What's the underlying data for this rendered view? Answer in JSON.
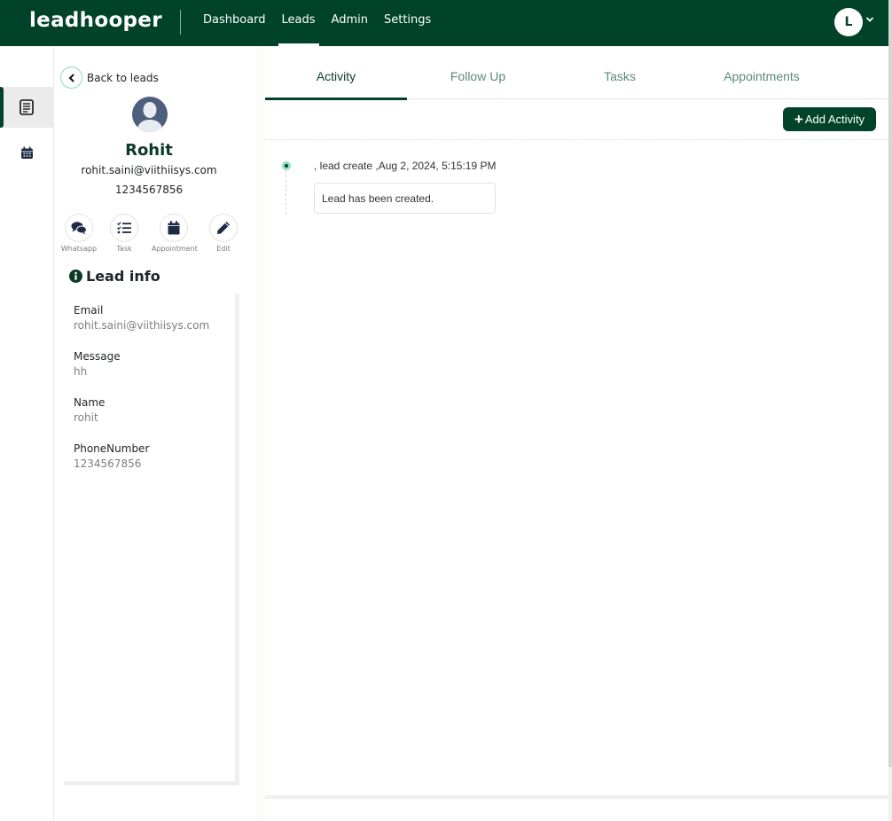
{
  "app": {
    "logo": "leadhooper"
  },
  "nav": {
    "items": [
      {
        "label": "Dashboard",
        "active": false
      },
      {
        "label": "Leads",
        "active": true
      },
      {
        "label": "Admin",
        "active": false
      },
      {
        "label": "Settings",
        "active": false
      }
    ],
    "user_initial": "L"
  },
  "rail": {
    "items": [
      {
        "icon": "document-icon",
        "active": true
      },
      {
        "icon": "calendar-icon",
        "active": false
      }
    ]
  },
  "profile": {
    "back_label": "Back to leads",
    "name": "Rohit",
    "email": "rohit.saini@viithiisys.com",
    "phone": "1234567856",
    "actions": [
      {
        "label": "Whatsapp",
        "icon": "chat-icon"
      },
      {
        "label": "Task",
        "icon": "task-list-icon"
      },
      {
        "label": "Appointment",
        "icon": "calendar-icon"
      },
      {
        "label": "Edit",
        "icon": "pencil-icon"
      }
    ],
    "info_title": "Lead info",
    "fields": [
      {
        "label": "Email",
        "value": "rohit.saini@viithiisys.com"
      },
      {
        "label": "Message",
        "value": "hh"
      },
      {
        "label": "Name",
        "value": "rohit"
      },
      {
        "label": "PhoneNumber",
        "value": "1234567856"
      }
    ]
  },
  "main": {
    "tabs": [
      {
        "label": "Activity",
        "active": true
      },
      {
        "label": "Follow Up",
        "active": false
      },
      {
        "label": "Tasks",
        "active": false
      },
      {
        "label": "Appointments",
        "active": false
      }
    ],
    "add_button_label": "Add Activity",
    "activities": [
      {
        "header": ", lead create ,Aug 2, 2024, 5:15:19 PM",
        "message": "Lead has been created."
      }
    ]
  },
  "colors": {
    "brand": "#00432a",
    "accent_light": "#8fe2bd"
  }
}
